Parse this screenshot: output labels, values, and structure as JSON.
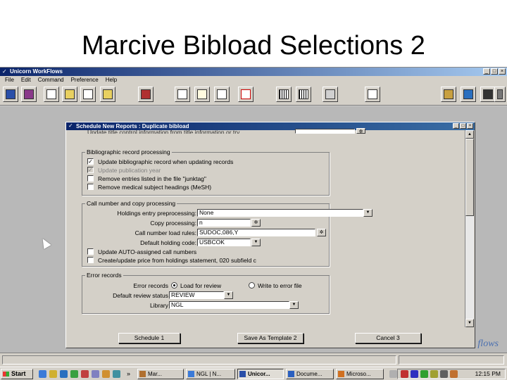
{
  "slide": {
    "title": "Marcive Bibload Selections 2"
  },
  "app": {
    "title": "Unicorn WorkFlows",
    "menu": [
      "File",
      "Edit",
      "Command",
      "Preference",
      "Help"
    ],
    "watermark": "flows"
  },
  "dialog": {
    "title": "Schedule New Reports : Duplicate bibload",
    "top_partial_label": "Update title control information from title information or try.",
    "biblio": {
      "legend": "Bibliographic record processing",
      "items": [
        {
          "label": "Update bibliographic record when updating records",
          "checked": true,
          "enabled": true
        },
        {
          "label": "Update publication year",
          "checked": true,
          "enabled": false
        },
        {
          "label": "Remove entries listed in the file \"junktag\"",
          "checked": false,
          "enabled": true
        },
        {
          "label": "Remove medical subject headings (MeSH)",
          "checked": false,
          "enabled": true
        }
      ]
    },
    "callnum": {
      "legend": "Call number and copy processing",
      "holdings_label": "Holdings entry preprocessing:",
      "holdings_value": "None",
      "copy_label": "Copy processing:",
      "copy_value": "n",
      "loadrules_label": "Call number load rules:",
      "loadrules_value": "SUDOC,086,Y",
      "holdingcode_label": "Default holding code:",
      "holdingcode_value": "USBCOK",
      "items": [
        {
          "label": "Update AUTO-assigned call numbers",
          "checked": false
        },
        {
          "label": "Create/update price from holdings statement, 020 subfield c",
          "checked": false
        }
      ]
    },
    "errors": {
      "legend": "Error records",
      "errorrec_label": "Error records",
      "radio_load": "Load for review",
      "radio_write": "Write to error file",
      "review_label": "Default review status",
      "review_value": "REVIEW",
      "library_label": "Library",
      "library_value": "NGL"
    },
    "buttons": {
      "schedule": "Schedule  1",
      "save_template": "Save As Template  2",
      "cancel": "Cancel  3"
    }
  },
  "taskbar": {
    "start": "Start",
    "tasks": [
      "Mar...",
      "NGL | N...",
      "Unicor...",
      "Docume...",
      "Microso...",
      "..."
    ],
    "clock": "12:15 PM"
  },
  "colors": {
    "titlebar": "#0a246a",
    "face": "#d4d0c8",
    "workspace": "#b8b8b8"
  }
}
